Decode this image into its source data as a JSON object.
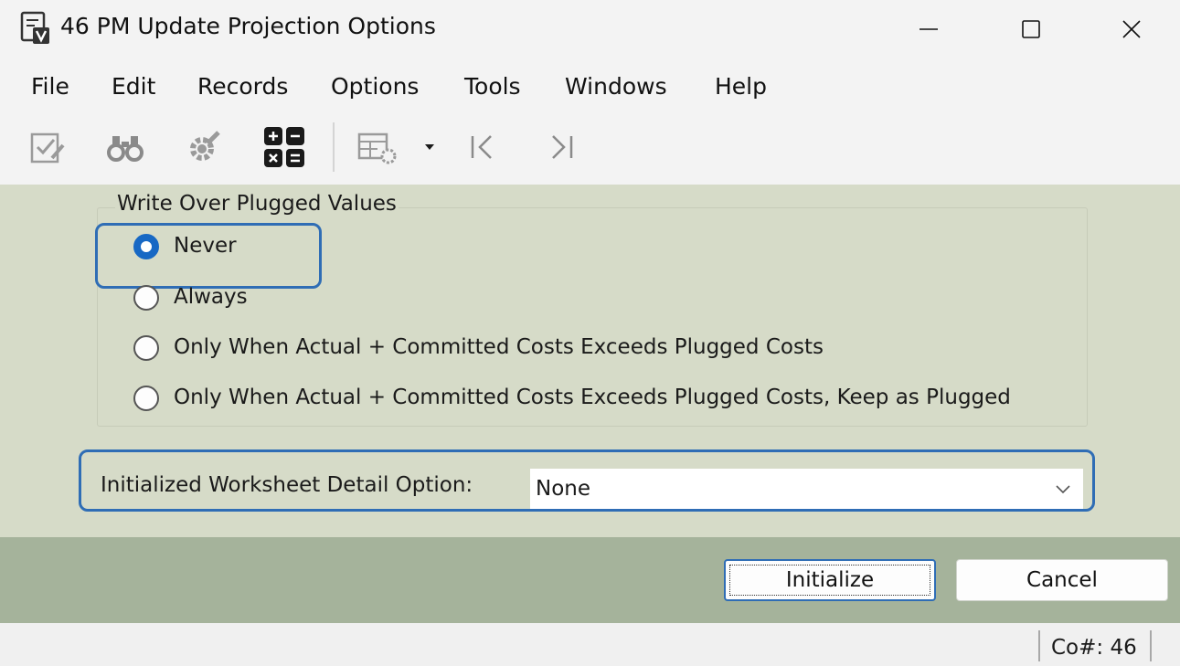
{
  "window": {
    "title": "46 PM Update Projection Options",
    "icons": {
      "app": "app-form-icon",
      "minimize": "minimize-icon",
      "maximize": "maximize-icon",
      "close": "close-icon"
    }
  },
  "menu": {
    "items": [
      "File",
      "Edit",
      "Records",
      "Options",
      "Tools",
      "Windows",
      "Help"
    ]
  },
  "toolbar": {
    "icons": [
      "edit-check-icon",
      "binoculars-icon",
      "settings-wrench-icon",
      "calculator-icon",
      "grid-settings-icon",
      "dropdown-arrow-icon",
      "first-record-icon",
      "last-record-icon"
    ]
  },
  "write_over": {
    "group_label": "Write Over Plugged Values",
    "selected": "Never",
    "options": [
      "Never",
      "Always",
      "Only When Actual + Committed Costs Exceeds Plugged Costs",
      "Only When Actual + Committed Costs Exceeds Plugged Costs, Keep as Plugged"
    ]
  },
  "detail_option": {
    "label": "Initialized Worksheet Detail Option:",
    "value": "None"
  },
  "buttons": {
    "initialize": "Initialize",
    "cancel": "Cancel"
  },
  "status": {
    "company": "Co#: 46"
  },
  "colors": {
    "panel": "#d6dbc8",
    "button_bar": "#a5b39b",
    "accent": "#1768c4",
    "focus_outline": "#2f6db5"
  }
}
